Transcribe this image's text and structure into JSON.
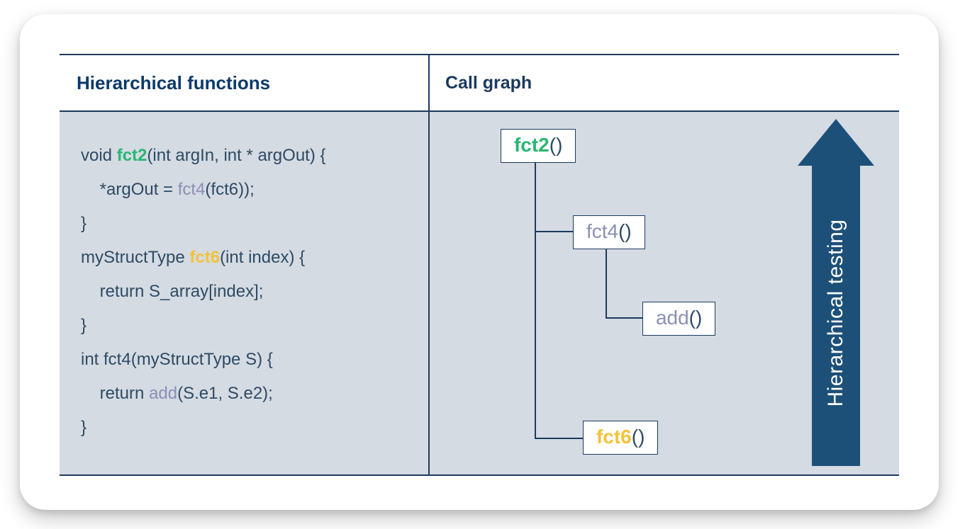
{
  "headers": {
    "left": "Hierarchical functions",
    "right": "Call graph"
  },
  "code": {
    "l1_pre": "void ",
    "l1_fn": "fct2",
    "l1_post": "(int argIn, int * argOut) {",
    "l2_pre": "    *argOut = ",
    "l2_fn": "fct4",
    "l2_post": "(fct6));",
    "l3": "}",
    "l4_pre": "myStructType ",
    "l4_fn": "fct6",
    "l4_post": "(int index) {",
    "l5": "    return S_array[index];",
    "l6": "}",
    "l7": "int fct4(myStructType S) {",
    "l8_pre": "    return ",
    "l8_fn": "add",
    "l8_post": "(S.e1, S.e2);",
    "l9": "}"
  },
  "graph": {
    "n1": "fct2",
    "n2": "fct4",
    "n3": "add",
    "n4": "fct6",
    "parens": "()"
  },
  "arrow": {
    "label": "Hierarchical testing"
  }
}
